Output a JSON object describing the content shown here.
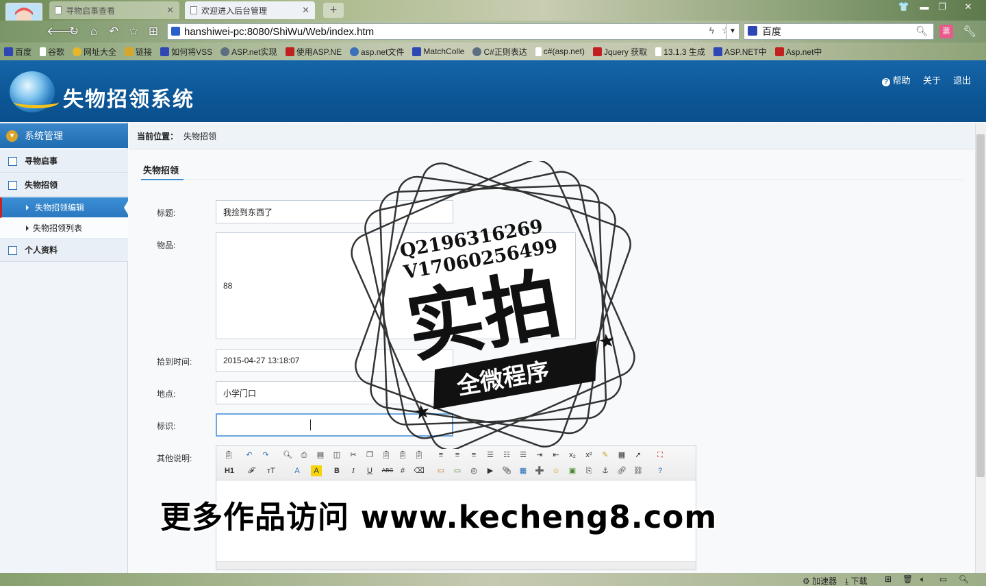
{
  "browser": {
    "tabs": [
      {
        "title": "寻物启事查看"
      },
      {
        "title": "欢迎进入后台管理"
      }
    ],
    "new_tab_label": "+",
    "url": "hanshiwei-pc:8080/ShiWu/Web/index.htm",
    "search_engine": "百度",
    "bookmarks": [
      {
        "label": "百度",
        "color": "#2f47b5"
      },
      {
        "label": "谷歌",
        "color": "#ffffff"
      },
      {
        "label": "网址大全",
        "color": "#e8b62a"
      },
      {
        "label": "链接",
        "color": "#d6a72a"
      },
      {
        "label": "如何将VSS",
        "color": "#2f47b5"
      },
      {
        "label": "ASP.net实现",
        "color": "#5c6f80"
      },
      {
        "label": "使用ASP.NE",
        "color": "#c22020"
      },
      {
        "label": "asp.net文件",
        "color": "#3c6fb8"
      },
      {
        "label": "MatchColle",
        "color": "#2f47b5"
      },
      {
        "label": "C#正则表达",
        "color": "#5c6f80"
      },
      {
        "label": "c#(asp.net)",
        "color": "#ffffff"
      },
      {
        "label": "Jquery 获取",
        "color": "#c22020"
      },
      {
        "label": "13.1.3 生成",
        "color": "#ffffff"
      },
      {
        "label": "ASP.NET中",
        "color": "#2f47b5"
      },
      {
        "label": "Asp.net中",
        "color": "#c22020"
      }
    ],
    "status": {
      "accelerator": "加速器",
      "download": "下载"
    }
  },
  "app": {
    "title": "失物招领系统",
    "top_links": {
      "help": "帮助",
      "about": "关于",
      "logout": "退出"
    },
    "sidebar": {
      "header": "系统管理",
      "items": [
        {
          "label": "寻物启事"
        },
        {
          "label": "失物招领"
        },
        {
          "label": "个人资料"
        }
      ],
      "sub_items": [
        {
          "label": "失物招领编辑"
        },
        {
          "label": "失物招领列表"
        }
      ]
    },
    "breadcrumb": {
      "label": "当前位置：",
      "value": "失物招领"
    },
    "section_title": "失物招领",
    "form": {
      "title_label": "标题:",
      "title_value": "我捡到东西了",
      "items_label": "物品:",
      "items_value": "88",
      "time_label": "拾到时间:",
      "time_value": "2015-04-27 13:18:07",
      "place_label": "地点:",
      "place_value": "小学门口",
      "id_label": "标识:",
      "id_value": "",
      "desc_label": "其他说明:"
    },
    "editor_toolbar_row2": {
      "h1": "H1",
      "bold": "B",
      "italic": "I",
      "underline": "U",
      "strike": "ABC"
    }
  },
  "overlays": {
    "stamp_line1": "Q2196316269",
    "stamp_line2": "V17060256499",
    "stamp_main": "实拍",
    "stamp_banner": "全微程序",
    "watermark": "更多作品访问 www.kecheng8.com"
  }
}
